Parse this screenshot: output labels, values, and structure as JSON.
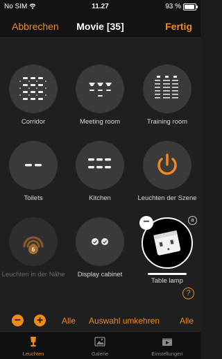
{
  "status": {
    "carrier": "No SIM",
    "time": "11.27",
    "battery": "93 %",
    "battery_level": 0.93
  },
  "nav": {
    "cancel": "Abbrechen",
    "title": "Movie [35]",
    "done": "Fertig"
  },
  "tiles": [
    {
      "label": "Corridor",
      "icon": "ceiling-lights-grid-icon"
    },
    {
      "label": "Meeting room",
      "icon": "spotlights-icon"
    },
    {
      "label": "Training room",
      "icon": "light-rows-icon"
    },
    {
      "label": "Toilets",
      "icon": "two-lights-icon"
    },
    {
      "label": "Kitchen",
      "icon": "six-lights-icon"
    },
    {
      "label": "Leuchten der Szene",
      "icon": "power-icon"
    },
    {
      "label": "Leuchten in der Nähe",
      "icon": "nearby-signal-icon",
      "badge": "6"
    },
    {
      "label": "Display cabinet",
      "icon": "display-lamps-icon"
    },
    {
      "label": "Table lamp",
      "icon": "device-photo-icon",
      "info": "a",
      "minus": "−"
    }
  ],
  "controls": {
    "minus": "−",
    "plus": "+",
    "all_1": "Alle",
    "invert": "Auswahl umkehren",
    "all_2": "Alle",
    "help": "?"
  },
  "tabs": [
    {
      "label": "Leuchten",
      "icon": "lamp-icon",
      "active": true
    },
    {
      "label": "Galerie",
      "icon": "gallery-icon",
      "active": false
    },
    {
      "label": "Einstellungen",
      "icon": "settings-film-icon",
      "active": false
    }
  ],
  "colors": {
    "accent": "#f08a1c",
    "background": "#1c1c1c",
    "tile": "#3a3a3a"
  }
}
